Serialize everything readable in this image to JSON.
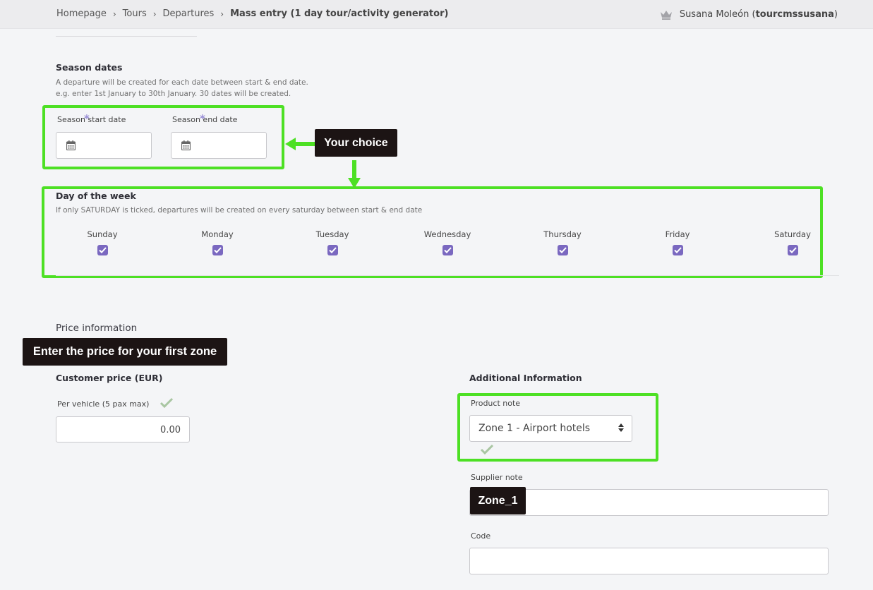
{
  "breadcrumb": {
    "items": [
      "Homepage",
      "Tours",
      "Departures"
    ],
    "current": "Mass entry (1 day tour/activity generator)"
  },
  "user": {
    "name": "Susana Moleón",
    "username": "tourcmssusana",
    "icon": "crown-icon"
  },
  "season": {
    "title": "Season dates",
    "desc1": "A departure will be created for each date between start & end date.",
    "desc2": "e.g. enter 1st January to 30th January. 30 dates will be created.",
    "start_label": "Season start date",
    "end_label": "Season end date",
    "start_value": "",
    "end_value": ""
  },
  "dow": {
    "title": "Day of the week",
    "desc": "If only SATURDAY is ticked, departures will be created on every saturday between start & end date",
    "days": [
      {
        "label": "Sunday",
        "checked": true
      },
      {
        "label": "Monday",
        "checked": true
      },
      {
        "label": "Tuesday",
        "checked": true
      },
      {
        "label": "Wednesday",
        "checked": true
      },
      {
        "label": "Thursday",
        "checked": true
      },
      {
        "label": "Friday",
        "checked": true
      },
      {
        "label": "Saturday",
        "checked": true
      }
    ]
  },
  "price": {
    "section_title": "Price information",
    "customer_price_title": "Customer price (EUR)",
    "per_vehicle_label": "Per vehicle (5 pax max)",
    "per_vehicle_value": "0.00"
  },
  "additional": {
    "title": "Additional Information",
    "product_note_label": "Product note",
    "product_note_value": "Zone 1 - Airport hotels",
    "supplier_note_label": "Supplier note",
    "supplier_note_value": "",
    "code_label": "Code",
    "code_value": ""
  },
  "annotations": {
    "your_choice": "Your choice",
    "first_zone": "Enter the price for your first zone",
    "zone_tag": "Zone_1",
    "highlight_color": "#4de024"
  },
  "colors": {
    "checkbox": "#7a68c0",
    "validation_check": "#a9c6a2",
    "tooltip_bg": "#1c1414"
  }
}
